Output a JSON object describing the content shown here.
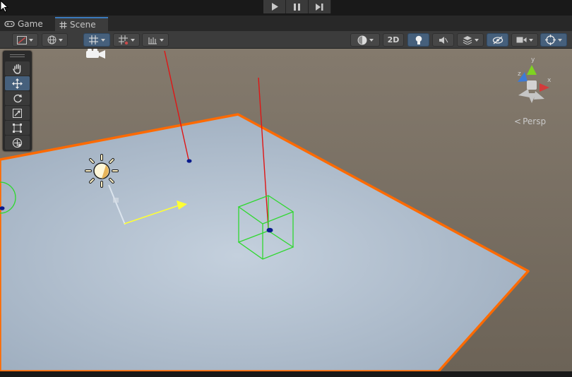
{
  "tabs": [
    {
      "label": "Game",
      "icon": "gamepad-icon"
    },
    {
      "label": "Scene",
      "icon": "hash-icon"
    }
  ],
  "toolbar": {
    "mode_2d_label": "2D"
  },
  "gizmo": {
    "projection_label": "Persp",
    "axis_labels": {
      "x": "x",
      "y": "y",
      "z": "z"
    }
  },
  "colors": {
    "accent": "#3a79bb",
    "selection_outline": "#ff6a00",
    "plane": "#aebccc",
    "ground": "#7c7265",
    "collider": "#2fd82f",
    "transform_arrow": "#ffff33"
  }
}
